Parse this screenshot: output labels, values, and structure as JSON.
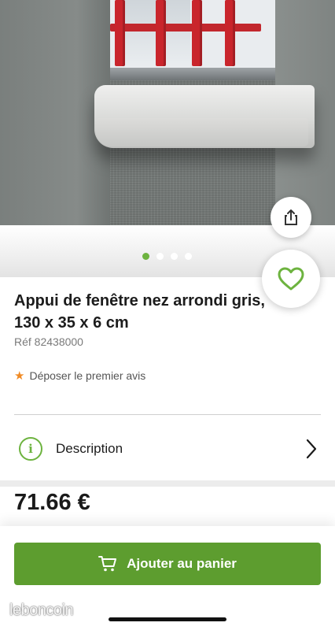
{
  "gallery": {
    "image_icon": "product-photo",
    "dots_count": 4,
    "active_dot": 0
  },
  "actions": {
    "share_icon": "share-icon",
    "favorite_icon": "heart-icon"
  },
  "product": {
    "title": "Appui de fenêtre nez arrondi gris, 130 x 35 x 6 cm",
    "reference": "Réf 82438000"
  },
  "reviews": {
    "star_icon": "star-icon",
    "link_label": "Déposer le premier avis"
  },
  "description": {
    "icon": "info-icon",
    "icon_glyph": "i",
    "label": "Description"
  },
  "price": {
    "value": "71.66 €"
  },
  "cart": {
    "icon": "cart-icon",
    "label": "Ajouter au panier"
  },
  "watermark": {
    "text": "leboncoin"
  },
  "colors": {
    "accent": "#6db33f",
    "button": "#5d9d2f",
    "star": "#f08a24"
  }
}
